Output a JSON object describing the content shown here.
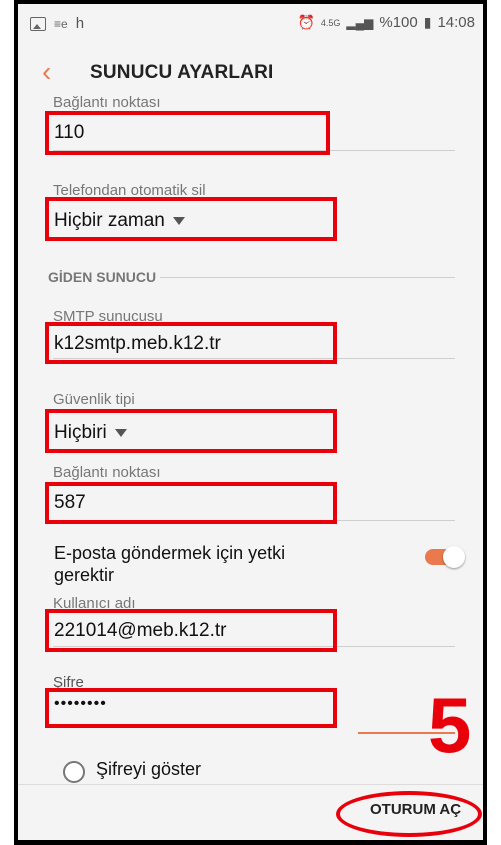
{
  "statusbar": {
    "left_text": "h",
    "network": "4.5G",
    "battery": "%100",
    "time": "14:08"
  },
  "appbar": {
    "title": "SUNUCU AYARLARI"
  },
  "incoming": {
    "port_label": "Bağlantı noktası",
    "port_value": "110",
    "delete_label": "Telefondan otomatik sil",
    "delete_value": "Hiçbir zaman"
  },
  "outgoing": {
    "section_title": "GİDEN SUNUCU",
    "smtp_label": "SMTP sunucusu",
    "smtp_value": "k12smtp.meb.k12.tr",
    "security_label": "Güvenlik tipi",
    "security_value": "Hiçbiri",
    "port_label": "Bağlantı noktası",
    "port_value": "587",
    "auth_label": "E-posta göndermek için yetki gerektir",
    "auth_enabled": true,
    "username_label": "Kullanıcı adı",
    "username_value": "221014@meb.k12.tr",
    "password_label": "Şifre",
    "password_value": "••••••••",
    "show_password_label": "Şifreyi göster"
  },
  "annotation": {
    "step_number": "5"
  },
  "footer": {
    "login_label": "OTURUM AÇ"
  },
  "colors": {
    "accent": "#e97a53",
    "highlight": "#e8000b"
  }
}
